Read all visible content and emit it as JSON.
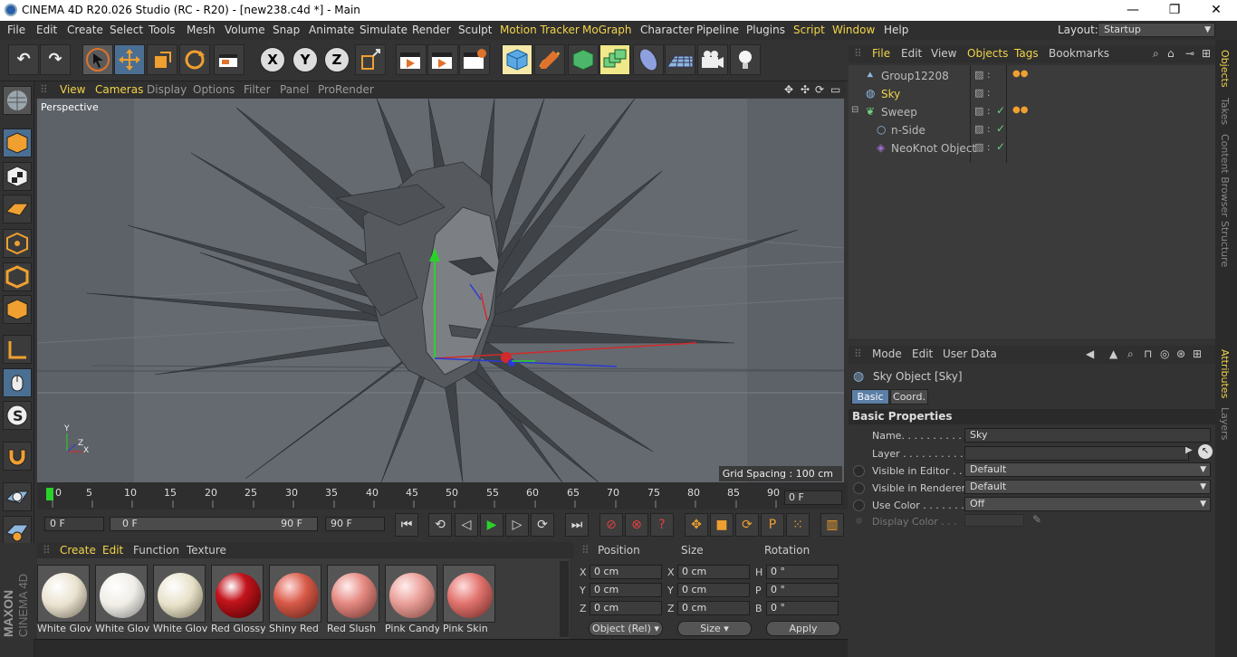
{
  "titlebar": {
    "title": "CINEMA 4D R20.026 Studio (RC - R20) - [new238.c4d *] - Main",
    "minimize": "—",
    "restore": "❐",
    "close": "✕"
  },
  "menubar": {
    "items": [
      "File",
      "Edit",
      "Create",
      "Select",
      "Tools",
      "Mesh",
      "Volume",
      "Snap",
      "Animate",
      "Simulate",
      "Render",
      "Sculpt",
      "Motion Tracker",
      "MoGraph",
      "Character",
      "Pipeline",
      "Plugins",
      "Script",
      "Window",
      "Help"
    ],
    "layout_label": "Layout:",
    "layout_value": "Startup"
  },
  "toolbar": {
    "undo": "↶",
    "redo": "↷",
    "axis_x": "X",
    "axis_y": "Y",
    "axis_z": "Z"
  },
  "viewport_menu": {
    "items": [
      "View",
      "Cameras",
      "Display",
      "Options",
      "Filter",
      "Panel",
      "ProRender"
    ],
    "label": "Perspective",
    "grid_spacing": "Grid Spacing : 100 cm",
    "axis_y": "Y",
    "axis_z": "Z",
    "axis_x": "X"
  },
  "timeline": {
    "ticks": [
      "0",
      "5",
      "10",
      "15",
      "20",
      "25",
      "30",
      "35",
      "40",
      "45",
      "50",
      "55",
      "60",
      "65",
      "70",
      "75",
      "80",
      "85",
      "90"
    ],
    "current_frame": "0 F"
  },
  "transport": {
    "start": "0 F",
    "range_start": "0 F",
    "range_end": "90 F",
    "end": "90 F"
  },
  "material_manager": {
    "menu": [
      "Create",
      "Edit",
      "Function",
      "Texture"
    ],
    "materials": [
      {
        "name": "White Glov",
        "color": "#e9e2cf"
      },
      {
        "name": "White Glov",
        "color": "#f0ede6"
      },
      {
        "name": "White Glov",
        "color": "#e7e1c9"
      },
      {
        "name": "Red Glossy",
        "color": "#c4141c"
      },
      {
        "name": "Shiny Red",
        "color": "#d85a48"
      },
      {
        "name": "Red Slush",
        "color": "#e58a82"
      },
      {
        "name": "Pink Candy",
        "color": "#eba19a"
      },
      {
        "name": "Pink Skin",
        "color": "#e2746e"
      }
    ]
  },
  "coord_manager": {
    "headers": [
      "Position",
      "Size",
      "Rotation"
    ],
    "rows": [
      {
        "a": "X",
        "pos": "0 cm",
        "b": "X",
        "size": "0 cm",
        "c": "H",
        "rot": "0 °"
      },
      {
        "a": "Y",
        "pos": "0 cm",
        "b": "Y",
        "size": "0 cm",
        "c": "P",
        "rot": "0 °"
      },
      {
        "a": "Z",
        "pos": "0 cm",
        "b": "Z",
        "size": "0 cm",
        "c": "B",
        "rot": "0 °"
      }
    ],
    "mode": "Object (Rel)",
    "size_mode": "Size",
    "apply": "Apply"
  },
  "object_manager": {
    "menu": [
      "File",
      "Edit",
      "View",
      "Objects",
      "Tags",
      "Bookmarks"
    ],
    "objects": [
      {
        "name": "Group12208",
        "selected": false
      },
      {
        "name": "Sky",
        "selected": true
      },
      {
        "name": "Sweep",
        "selected": false
      },
      {
        "name": "n-Side",
        "selected": false
      },
      {
        "name": "NeoKnot Object",
        "selected": false
      }
    ]
  },
  "attribute_manager": {
    "menu": [
      "Mode",
      "Edit",
      "User Data"
    ],
    "object_title": "Sky Object [Sky]",
    "tabs": [
      "Basic",
      "Coord."
    ],
    "section": "Basic Properties",
    "name_label": "Name. . . . . . . . . . . . .",
    "name_value": "Sky",
    "layer_label": "Layer . . . . . . . . . . . . .",
    "visible_editor_label": "Visible in Editor . . .",
    "visible_editor_value": "Default",
    "visible_renderer_label": "Visible in Renderer",
    "visible_renderer_value": "Default",
    "use_color_label": "Use Color . . . . . . . .",
    "use_color_value": "Off",
    "display_color_label": "Display Color . . ."
  },
  "right_tabs": [
    "Objects",
    "Takes",
    "Content Browser",
    "Structure",
    "Attributes",
    "Layers"
  ],
  "maxon_logo": "MAXON CINEMA 4D"
}
